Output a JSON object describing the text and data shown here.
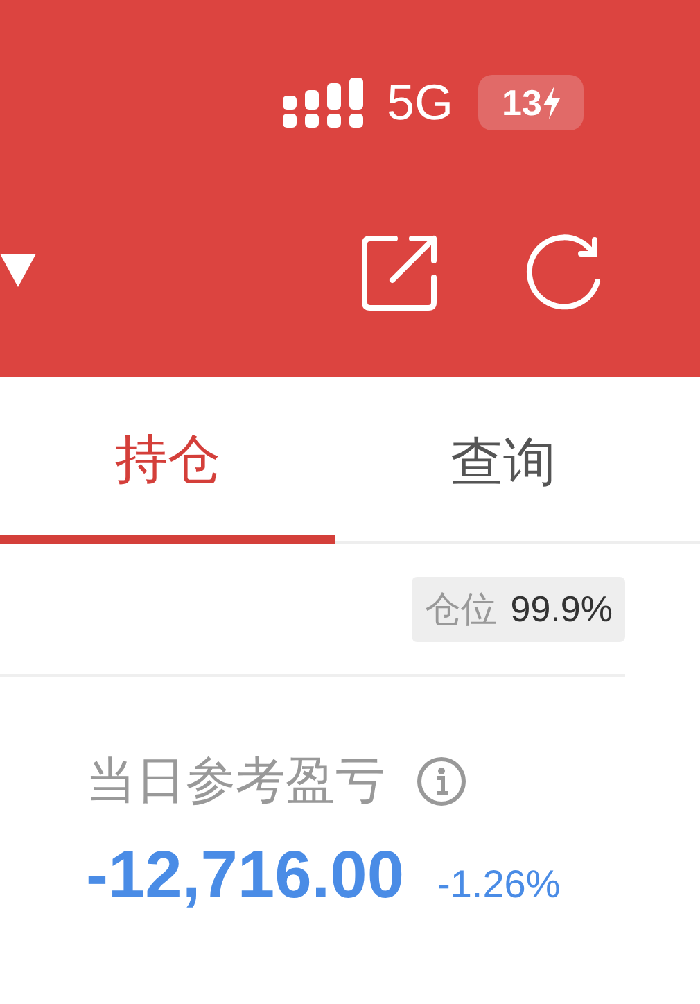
{
  "status_bar": {
    "network": "5G",
    "battery": "13"
  },
  "tabs": [
    {
      "label": "持仓",
      "selected": true
    },
    {
      "label": "查询",
      "selected": false
    }
  ],
  "position": {
    "label": "仓位",
    "value": "99.9%"
  },
  "daily_pnl": {
    "label": "当日参考盈亏",
    "value": "-12,716.00",
    "percent": "-1.26%"
  }
}
